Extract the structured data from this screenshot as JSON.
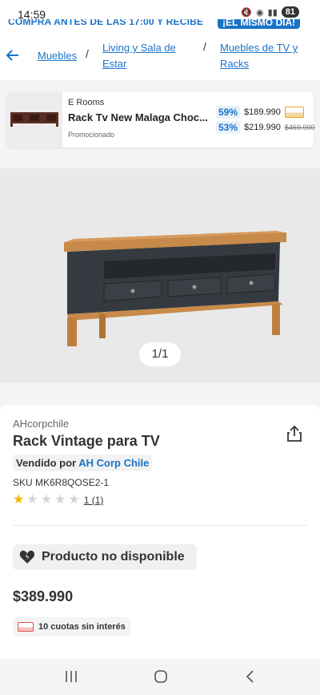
{
  "status": {
    "time": "14:59",
    "battery": "81"
  },
  "promo": {
    "text": "COMPRA ANTES DE LAS 17:00 Y RECIBE",
    "highlight": "¡EL MISMO DÍA!"
  },
  "breadcrumb": [
    "Muebles",
    "Living y Sala de Estar",
    "Muebles de TV y Racks"
  ],
  "ad": {
    "brand": "E Rooms",
    "title": "Rack Tv New Malaga Choc...",
    "tag": "Promocionado",
    "offers": [
      {
        "discount": "59%",
        "price": "$189.990"
      },
      {
        "discount": "53%",
        "price": "$219.990",
        "old_price": "$469.990"
      }
    ]
  },
  "gallery": {
    "counter": "1/1"
  },
  "product": {
    "seller_small": "AHcorpchile",
    "title": "Rack Vintage para TV",
    "sold_by_prefix": "Vendido por",
    "seller": "AH Corp Chile",
    "sku": "SKU MK6R8QOSE2-1",
    "rating": 1,
    "rating_max": 5,
    "rating_count": "1 (1)",
    "availability": "Producto no disponible",
    "price": "$389.990",
    "installments": "10 cuotas sin interés"
  },
  "colors": {
    "link": "#1a73c8",
    "star": "#f0b400"
  }
}
